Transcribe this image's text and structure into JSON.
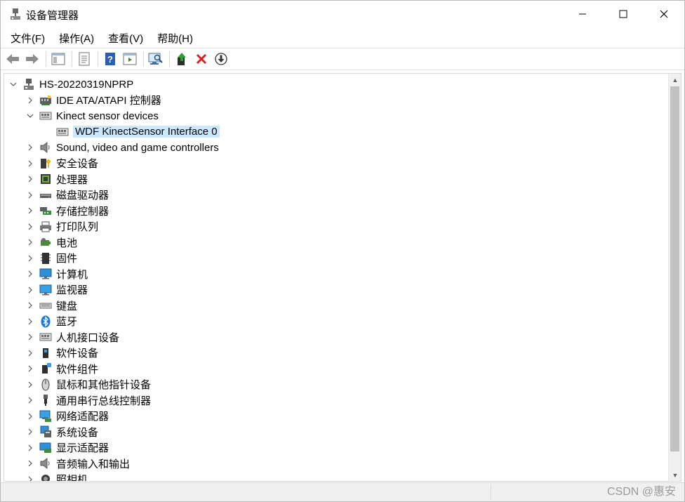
{
  "window": {
    "title": "设备管理器",
    "controls": {
      "minimize": "—",
      "maximize": "☐",
      "close": "✕"
    }
  },
  "menu": [
    "文件(F)",
    "操作(A)",
    "查看(V)",
    "帮助(H)"
  ],
  "toolbar": {
    "buttons": [
      "back-arrow",
      "forward-arrow",
      "show-hide-console-tree",
      "properties",
      "help",
      "action-pane",
      "scan-hardware",
      "update-driver",
      "uninstall-device",
      "disable-device"
    ]
  },
  "tree": {
    "root": "HS-20220319NPRP",
    "items": [
      {
        "label": "IDE ATA/ATAPI 控制器",
        "icon": "ide-controller-icon",
        "expanded": false
      },
      {
        "label": "Kinect sensor devices",
        "icon": "kinect-icon",
        "expanded": true
      },
      {
        "label": "WDF KinectSensor Interface 0",
        "icon": "kinect-device-icon",
        "child": true,
        "selected": true
      },
      {
        "label": "Sound, video and game controllers",
        "icon": "speaker-icon",
        "expanded": false
      },
      {
        "label": "安全设备",
        "icon": "security-device-icon",
        "expanded": false
      },
      {
        "label": "处理器",
        "icon": "processor-icon",
        "expanded": false
      },
      {
        "label": "磁盘驱动器",
        "icon": "disk-drive-icon",
        "expanded": false
      },
      {
        "label": "存储控制器",
        "icon": "storage-controller-icon",
        "expanded": false
      },
      {
        "label": "打印队列",
        "icon": "printer-icon",
        "expanded": false
      },
      {
        "label": "电池",
        "icon": "battery-icon",
        "expanded": false
      },
      {
        "label": "固件",
        "icon": "firmware-icon",
        "expanded": false
      },
      {
        "label": "计算机",
        "icon": "computer-icon",
        "expanded": false
      },
      {
        "label": "监视器",
        "icon": "monitor-icon",
        "expanded": false
      },
      {
        "label": "键盘",
        "icon": "keyboard-icon",
        "expanded": false
      },
      {
        "label": "蓝牙",
        "icon": "bluetooth-icon",
        "expanded": false
      },
      {
        "label": "人机接口设备",
        "icon": "hid-icon",
        "expanded": false
      },
      {
        "label": "软件设备",
        "icon": "software-device-icon",
        "expanded": false
      },
      {
        "label": "软件组件",
        "icon": "software-component-icon",
        "expanded": false
      },
      {
        "label": "鼠标和其他指针设备",
        "icon": "mouse-icon",
        "expanded": false
      },
      {
        "label": "通用串行总线控制器",
        "icon": "usb-icon",
        "expanded": false
      },
      {
        "label": "网络适配器",
        "icon": "network-adapter-icon",
        "expanded": false
      },
      {
        "label": "系统设备",
        "icon": "system-device-icon",
        "expanded": false
      },
      {
        "label": "显示适配器",
        "icon": "display-adapter-icon",
        "expanded": false
      },
      {
        "label": "音频输入和输出",
        "icon": "audio-io-icon",
        "expanded": false
      },
      {
        "label": "照相机",
        "icon": "camera-icon",
        "expanded": false
      }
    ]
  },
  "watermark": "CSDN @惠安",
  "colors": {
    "selection": "#cce8ff",
    "accent": "#0078d7"
  }
}
